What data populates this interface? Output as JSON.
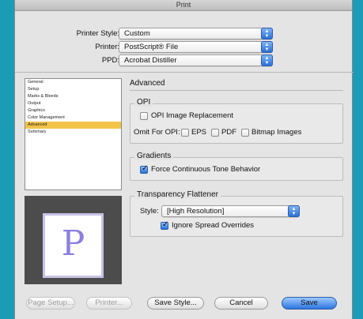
{
  "window": {
    "title": "Print"
  },
  "top_rows": {
    "printer_style": {
      "label": "Printer Style:",
      "value": "Custom"
    },
    "printer": {
      "label": "Printer:",
      "value": "PostScript® File"
    },
    "ppd": {
      "label": "PPD:",
      "value": "Acrobat Distiller"
    }
  },
  "sidebar": {
    "items": [
      {
        "label": "General"
      },
      {
        "label": "Setup"
      },
      {
        "label": "Marks & Bleeds"
      },
      {
        "label": "Output"
      },
      {
        "label": "Graphics"
      },
      {
        "label": "Color Management"
      },
      {
        "label": "Advanced",
        "selected": true
      },
      {
        "label": "Summary"
      }
    ]
  },
  "preview": {
    "letter": "P"
  },
  "panel": {
    "title": "Advanced",
    "opi": {
      "label": "OPI",
      "image_replacement": {
        "label": "OPI Image Replacement",
        "checked": false
      },
      "omit_label": "Omit For OPI:",
      "eps": {
        "label": "EPS",
        "checked": false
      },
      "pdf": {
        "label": "PDF",
        "checked": false
      },
      "bitmap": {
        "label": "Bitmap Images",
        "checked": false
      }
    },
    "gradients": {
      "label": "Gradients",
      "force_continuous": {
        "label": "Force Continuous Tone Behavior",
        "checked": true
      }
    },
    "transparency": {
      "label": "Transparency Flattener",
      "style_label": "Style:",
      "style_value": "[High Resolution]",
      "ignore_spread": {
        "label": "Ignore Spread Overrides",
        "checked": true
      }
    }
  },
  "buttons": {
    "page_setup": "Page Setup...",
    "printer": "Printer...",
    "save_style": "Save Style...",
    "cancel": "Cancel",
    "save": "Save"
  }
}
